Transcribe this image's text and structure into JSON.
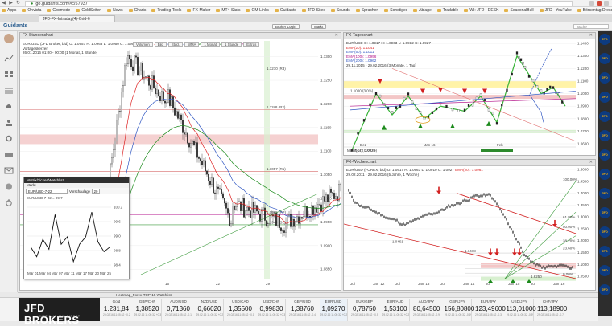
{
  "browser": {
    "url": "go.guidants.com/#c/57937",
    "tab_title": "JFD-FX-Intraday(4)-Grid-6",
    "bookmarks": [
      "Apps",
      "Onvista",
      "Godmode",
      "GoldSeiten",
      "News",
      "Charts",
      "Trading-Tools",
      "FX-Maker",
      "MT4-Stats",
      "GM-Links",
      "Guidants",
      "JFD-Sites",
      "Sounds",
      "Sprachen",
      "Sonstiges",
      "Ablage",
      "Tradable",
      "WI: JFD - DESK",
      "SeasonalBull",
      "JFD - YouTube",
      "Börsentag Dresden"
    ]
  },
  "app": {
    "logo": "Guidants",
    "buttons": [
      "Broker Login",
      "Markt"
    ],
    "search_placeholder": "Suche"
  },
  "chart_main": {
    "header": "FX-Stundenchart",
    "legend": {
      "line1": "EUR/USD (JFD Broker, bid)  O: 1.0957  H: 1.0963  L: 1.0950  C: 1.0957",
      "ema20": "EMA(20): 1.0940",
      "ema50": "EMA(50): 1.0977",
      "ema100": "EMA(100): 1.1005",
      "pp": "PP(0): 1.0965",
      "line2": "Vortageskerzen",
      "line3": "26.01.2016 01:00 - 00:00 (1 Monat, 1 Stunde)"
    },
    "toolbar": [
      "Volumen",
      "Bild",
      "Stdd.",
      "WMA",
      "1 Monat",
      "1 Stunde",
      "Extras"
    ],
    "level_labels": [
      "1.1270 (R3)",
      "1.1188 (R2)",
      "1.1057 (R1)",
      "1.0965 (PP)",
      "1.0944 (S1)"
    ],
    "price_ticks": [
      "1.1300",
      "1.1250",
      "1.1200",
      "1.1150",
      "1.1100",
      "1.1050",
      "1.1000",
      "1.0950",
      "1.0900",
      "1.0850"
    ],
    "date_ticks": [
      "15",
      "22",
      "29"
    ]
  },
  "chart_daily": {
    "header": "FX-Tageschart",
    "legend": {
      "line1": "EUR/USD  O: 1.0917  H: 1.0963  L: 1.0912  C: 1.0927",
      "ema20": "EMA(20): 1.1041",
      "ema50": "EMA(50): 1.1011",
      "ema100": "EMA(100): 1.0996",
      "ema200": "EMA(200): 1.0962",
      "line2": "29.11.2015 - 29.02.2016 (3 Monate, 1 Tag)"
    },
    "annotations": [
      "1.1000 (3.0%)",
      "1.0522 (100.0%)"
    ],
    "indicator_label": "MOM(14): 0.0326",
    "price_ticks": [
      "1.1400",
      "1.1300",
      "1.1200",
      "1.1100",
      "1.1000",
      "1.0900",
      "1.0800",
      "1.0700",
      "1.0600"
    ],
    "date_ticks": [
      "Dez",
      "Jan 16",
      "Feb"
    ]
  },
  "chart_weekly": {
    "header": "FX-Wochenchart",
    "legend": {
      "line1": "EUR/USD (FOREX, bid)  O: 1.0917  H: 1.0963  L: 1.0910  C: 1.0927",
      "ema20": "EMA(20): 1.0961",
      "line2": "29.02.2011 - 29.02.2016 (5 Jahre, 1 Woche)"
    },
    "annotations": [
      "1.0461",
      "1.1478",
      "1.6250",
      "100.00%",
      "61.80%",
      "38.20%",
      "23.60%",
      "50.00%",
      "0.00%"
    ],
    "price_ticks": [
      "1.5000",
      "1.4500",
      "1.4000",
      "1.3500",
      "1.3000",
      "1.2500",
      "1.2000",
      "1.1500",
      "1.1000",
      "1.0500"
    ],
    "date_ticks": [
      "Jul",
      "Jan '12",
      "Jul",
      "Jan '13",
      "Jul",
      "Jan '14",
      "Jul",
      "Jan '15",
      "Jul",
      "Jan '16"
    ]
  },
  "mini_chart": {
    "title": "Matrix/Ticker/Watchlist",
    "subtitle": "Markt",
    "selected_market": "EUR/USD-7-22",
    "period_label": "Vorschaulage",
    "period_value": "20",
    "legend": "EUR/USD-7-22 = 99.7",
    "y_ticks": [
      "100.2",
      "99.6",
      "99.0",
      "98.8",
      "98.4"
    ],
    "x_ticks": [
      "Mär 01",
      "Mär 04",
      "Mär 07",
      "Mär 11",
      "Mär 17",
      "Mär 20",
      "Mär 25"
    ]
  },
  "watchlist": {
    "header": "Heatmap_Forex-TOP-15 Watchlist",
    "logo_main": "JFD BROKERS",
    "logo_tag": "JUST FAIR AND DIRECT",
    "items": [
      {
        "symbol": "Gold",
        "price": "1.231,84",
        "meta": "29.02.16 11:05:32 +0,2%"
      },
      {
        "symbol": "GBP/CHF",
        "price": "1,38520",
        "meta": "29.02.16 11:05:32 +0,3%"
      },
      {
        "symbol": "AUD/USD",
        "price": "0,71360",
        "meta": "29.02.16 11:05:32 -0,1%"
      },
      {
        "symbol": "NZD/USD",
        "price": "0,66020",
        "meta": "29.02.16 11:05:32 +0,2%"
      },
      {
        "symbol": "USD/CAD",
        "price": "1,35500",
        "meta": "29.02.16 11:05:32 +0,1%"
      },
      {
        "symbol": "USD/CHF",
        "price": "0,99830",
        "meta": "29.02.16 11:05:32 +0,3%"
      },
      {
        "symbol": "GBP/USD",
        "price": "1,38760",
        "meta": "29.02.16 11:05:32 -0,4%"
      },
      {
        "symbol": "EUR/USD",
        "price": "1,09270",
        "meta": "29.02.16 11:05:32 +0,2%"
      },
      {
        "symbol": "EUR/GBP",
        "price": "0,78750",
        "meta": "29.02.16 11:05:32 +0,5%"
      },
      {
        "symbol": "EUR/AUD",
        "price": "1,53100",
        "meta": "29.02.16 11:05:32 +0,2%"
      },
      {
        "symbol": "AUD/JPY",
        "price": "80,64500",
        "meta": "29.02.16 11:05:32 -0,9%"
      },
      {
        "symbol": "GBP/JPY",
        "price": "156,80800",
        "meta": "29.02.16 11:05:32 -0,6%"
      },
      {
        "symbol": "EUR/JPY",
        "price": "123,49600",
        "meta": "29.02.16 11:05:32 -0,3%"
      },
      {
        "symbol": "USD/JPY",
        "price": "113,01000",
        "meta": "29.02.16 11:05:32 -0,5%"
      },
      {
        "symbol": "CHF/JPY",
        "price": "113,18900",
        "meta": "29.02.16 11:05:32 -0,7%"
      }
    ]
  },
  "colors": {
    "accent": "#2b5e8f",
    "up_arrow": "#1c8a1c",
    "down_arrow": "#d21f1f",
    "resistance_fill": "#f3c6c6",
    "support_fill": "#fff3a8"
  }
}
